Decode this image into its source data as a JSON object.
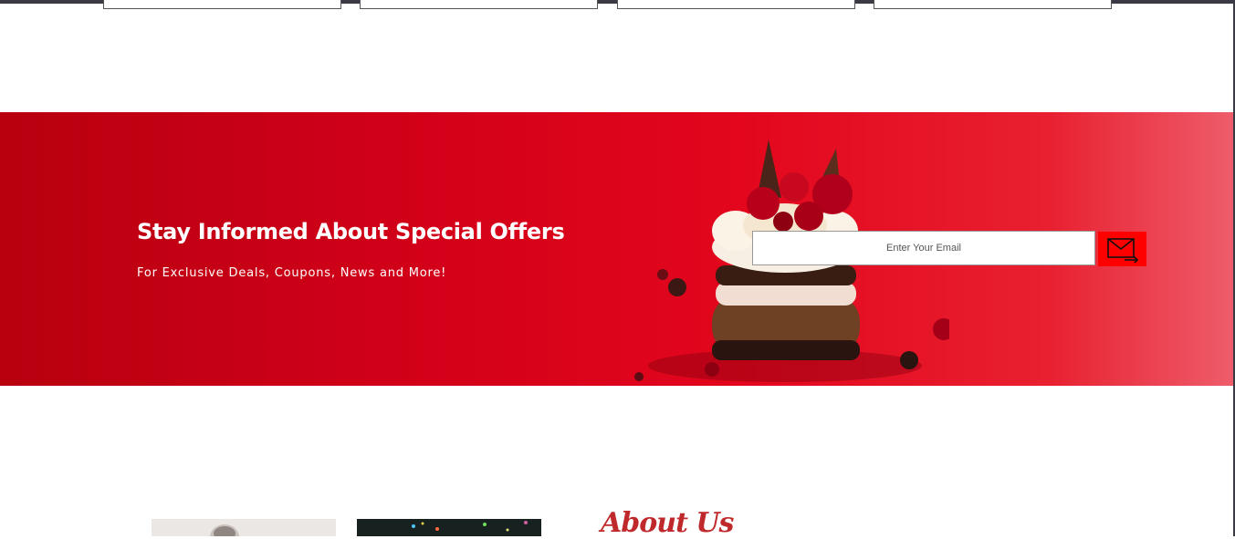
{
  "newsletter": {
    "title": "Stay Informed About Special Offers",
    "subtitle": "For Exclusive Deals, Coupons, News and More!",
    "email_placeholder": "Enter Your Email",
    "submit_icon": "envelope-arrow-icon"
  },
  "about": {
    "title": "About Us"
  },
  "colors": {
    "banner_red": "#d1001a",
    "button_red": "#ff0000",
    "about_title": "#c0292b"
  }
}
